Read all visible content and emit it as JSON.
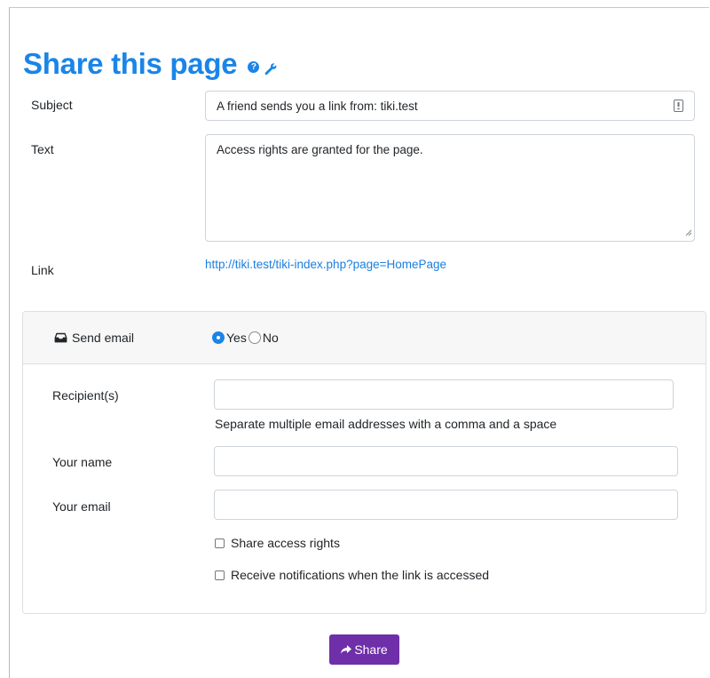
{
  "page": {
    "title": "Share this page",
    "accent_color": "#1a85e8",
    "title_icons": [
      "help-icon",
      "wrench-icon"
    ]
  },
  "form": {
    "subject_label": "Subject",
    "subject_value": "A friend sends you a link from:  tiki.test",
    "text_label": "Text",
    "text_value": "Access rights are granted for the page.",
    "link_label": "Link",
    "link_value": "http://tiki.test/tiki-index.php?page=HomePage"
  },
  "email_section": {
    "send_email_label": "Send email",
    "send_email_icon": "inbox-icon",
    "options": [
      {
        "label": "Yes",
        "selected": true
      },
      {
        "label": "No",
        "selected": false
      }
    ],
    "recipients_label": "Recipient(s)",
    "recipients_value": "",
    "recipients_help": "Separate multiple email addresses with a comma and a space",
    "your_name_label": "Your name",
    "your_name_value": "",
    "your_email_label": "Your email",
    "your_email_value": "",
    "share_access_rights_label": "Share access rights",
    "share_access_rights_checked": false,
    "receive_notifications_label": "Receive notifications when the link is accessed",
    "receive_notifications_checked": false
  },
  "actions": {
    "share_label": "Share",
    "share_icon": "share-arrow-icon",
    "share_color": "#6f2fa8"
  }
}
